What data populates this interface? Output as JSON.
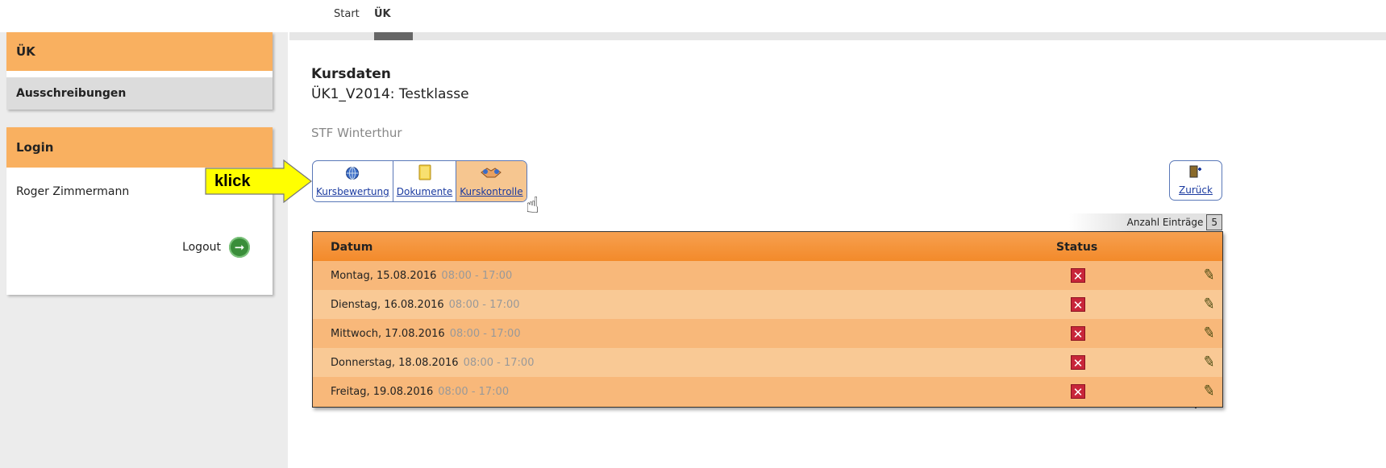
{
  "nav": {
    "tabs": [
      {
        "label": "Start"
      },
      {
        "label": "ÜK"
      }
    ]
  },
  "sidebar": {
    "section_uk": "ÜK",
    "item_ausschreibungen": "Ausschreibungen",
    "section_login": "Login",
    "username": "Roger Zimmermann",
    "logout_label": "Logout"
  },
  "annotation": {
    "arrow_label": "klick",
    "arrow_color": "#ffff00"
  },
  "main": {
    "title": "Kursdaten",
    "subtitle": "ÜK1_V2014: Testklasse",
    "location": "STF Winterthur",
    "buttons": [
      {
        "label": "Kursbewertung",
        "icon": "globe-icon"
      },
      {
        "label": "Dokumente",
        "icon": "folder-icon"
      },
      {
        "label": "Kurskontrolle",
        "icon": "handshake-icon",
        "active": true
      }
    ],
    "back_label": "Zurück",
    "anzahl_label": "Anzahl Einträge",
    "anzahl_value": "5"
  },
  "table": {
    "headers": {
      "datum": "Datum",
      "status": "Status"
    },
    "rows": [
      {
        "date": "Montag, 15.08.2016",
        "time": "08:00 - 17:00",
        "status": "x"
      },
      {
        "date": "Dienstag, 16.08.2016",
        "time": "08:00 - 17:00",
        "status": "x"
      },
      {
        "date": "Mittwoch, 17.08.2016",
        "time": "08:00 - 17:00",
        "status": "x"
      },
      {
        "date": "Donnerstag, 18.08.2016",
        "time": "08:00 - 17:00",
        "status": "x"
      },
      {
        "date": "Freitag, 19.08.2016",
        "time": "08:00 - 17:00",
        "status": "x"
      }
    ]
  },
  "colors": {
    "accent_orange": "#f9b060",
    "table_header": "#f38a2a",
    "status_red": "#c8263a",
    "link_blue": "#1a3aa0"
  }
}
